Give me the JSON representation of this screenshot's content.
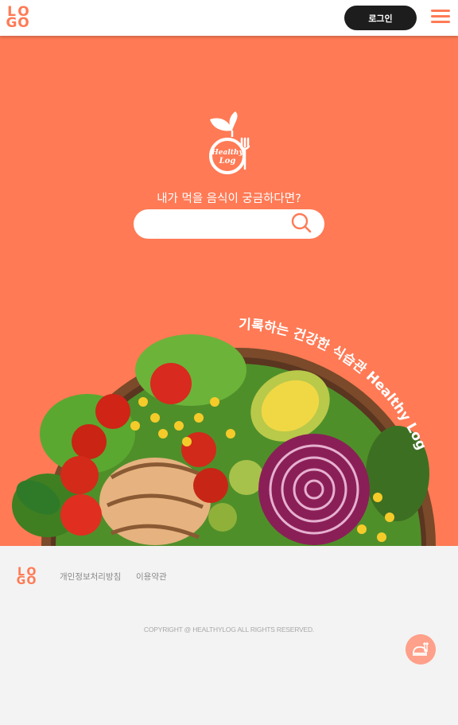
{
  "header": {
    "logo_letters": [
      "L",
      "O",
      "G",
      "O"
    ],
    "login_label": "로그인",
    "menu_icon": "hamburger-menu-icon"
  },
  "hero": {
    "brand_logo_text": [
      "Healthy",
      "Log"
    ],
    "tagline": "내가 먹을 음식이 궁금하다면?",
    "search": {
      "value": "",
      "placeholder": "",
      "icon": "search-icon"
    },
    "curved_text": "기록하는 건강한 식습관 Healthy Log",
    "image": "salad-bowl-image"
  },
  "footer": {
    "logo_letters": [
      "L",
      "O",
      "G",
      "O"
    ],
    "links": [
      "개인정보처리방침",
      "이용약관"
    ],
    "copyright": "COPYRIGHT @ HEALTHYLOG ALL RIGHTS RESERVED.",
    "fab_icon": "food-tray-icon"
  },
  "colors": {
    "accent": "#ff7a55",
    "header_bg": "#ffffff",
    "footer_bg": "#f3f3f3",
    "button_dark": "#1d1d1d",
    "fab": "#ffa08a"
  }
}
